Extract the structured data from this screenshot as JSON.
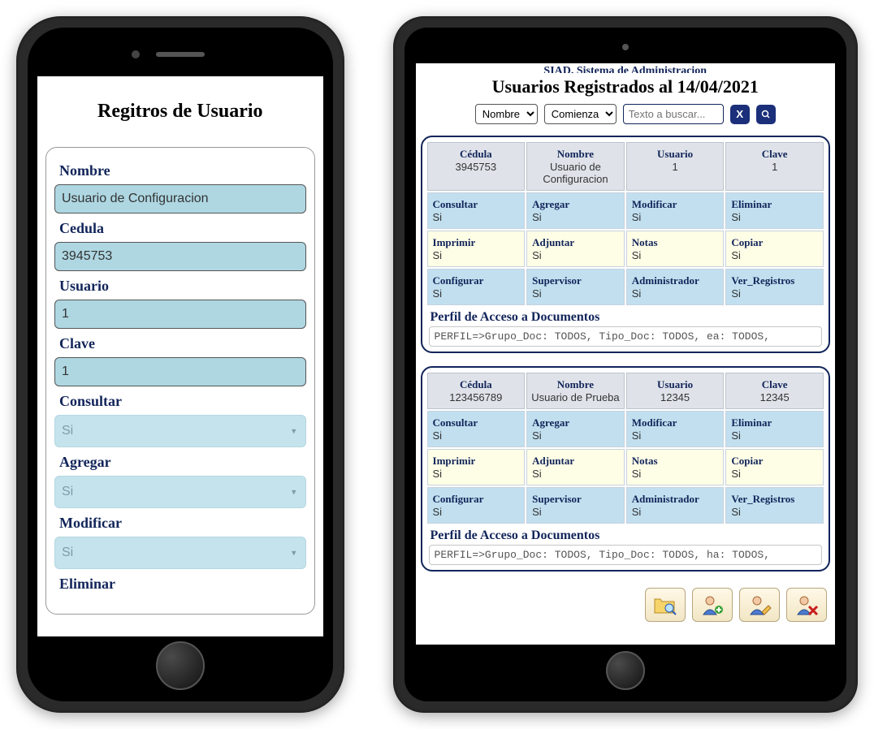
{
  "phone": {
    "title": "Regitros de Usuario",
    "labels": {
      "nombre": "Nombre",
      "cedula": "Cedula",
      "usuario": "Usuario",
      "clave": "Clave",
      "consultar": "Consultar",
      "agregar": "Agregar",
      "modificar": "Modificar",
      "eliminar": "Eliminar"
    },
    "values": {
      "nombre": "Usuario de Configuracion",
      "cedula": "3945753",
      "usuario": "1",
      "clave": "1",
      "consultar": "Si",
      "agregar": "Si",
      "modificar": "Si"
    }
  },
  "tablet": {
    "cut_title": "SIAD. Sistema de Administracion",
    "title": "Usuarios Registrados al 14/04/2021",
    "search": {
      "field": "Nombre",
      "mode": "Comienza",
      "placeholder": "Texto a buscar...",
      "clear": "X"
    },
    "headers": {
      "cedula": "Cédula",
      "nombre": "Nombre",
      "usuario": "Usuario",
      "clave": "Clave"
    },
    "perm_labels": {
      "consultar": "Consultar",
      "agregar": "Agregar",
      "modificar": "Modificar",
      "eliminar": "Eliminar",
      "imprimir": "Imprimir",
      "adjuntar": "Adjuntar",
      "notas": "Notas",
      "copiar": "Copiar",
      "configurar": "Configurar",
      "supervisor": "Supervisor",
      "administrador": "Administrador",
      "ver_registros": "Ver_Registros"
    },
    "perfil_title": "Perfil de Acceso a Documentos",
    "records": [
      {
        "cedula": "3945753",
        "nombre": "Usuario de Configuracion",
        "usuario": "1",
        "clave": "1",
        "perms": {
          "consultar": "Si",
          "agregar": "Si",
          "modificar": "Si",
          "eliminar": "Si",
          "imprimir": "Si",
          "adjuntar": "Si",
          "notas": "Si",
          "copiar": "Si",
          "configurar": "Si",
          "supervisor": "Si",
          "administrador": "Si",
          "ver_registros": "Si"
        },
        "perfil": "PERFIL=>Grupo_Doc: TODOS, Tipo_Doc: TODOS, ea: TODOS,"
      },
      {
        "cedula": "123456789",
        "nombre": "Usuario de Prueba",
        "usuario": "12345",
        "clave": "12345",
        "perms": {
          "consultar": "Si",
          "agregar": "Si",
          "modificar": "Si",
          "eliminar": "Si",
          "imprimir": "Si",
          "adjuntar": "Si",
          "notas": "Si",
          "copiar": "Si",
          "configurar": "Si",
          "supervisor": "Si",
          "administrador": "Si",
          "ver_registros": "Si"
        },
        "perfil": "PERFIL=>Grupo_Doc: TODOS, Tipo_Doc: TODOS, ha: TODOS,"
      }
    ]
  }
}
